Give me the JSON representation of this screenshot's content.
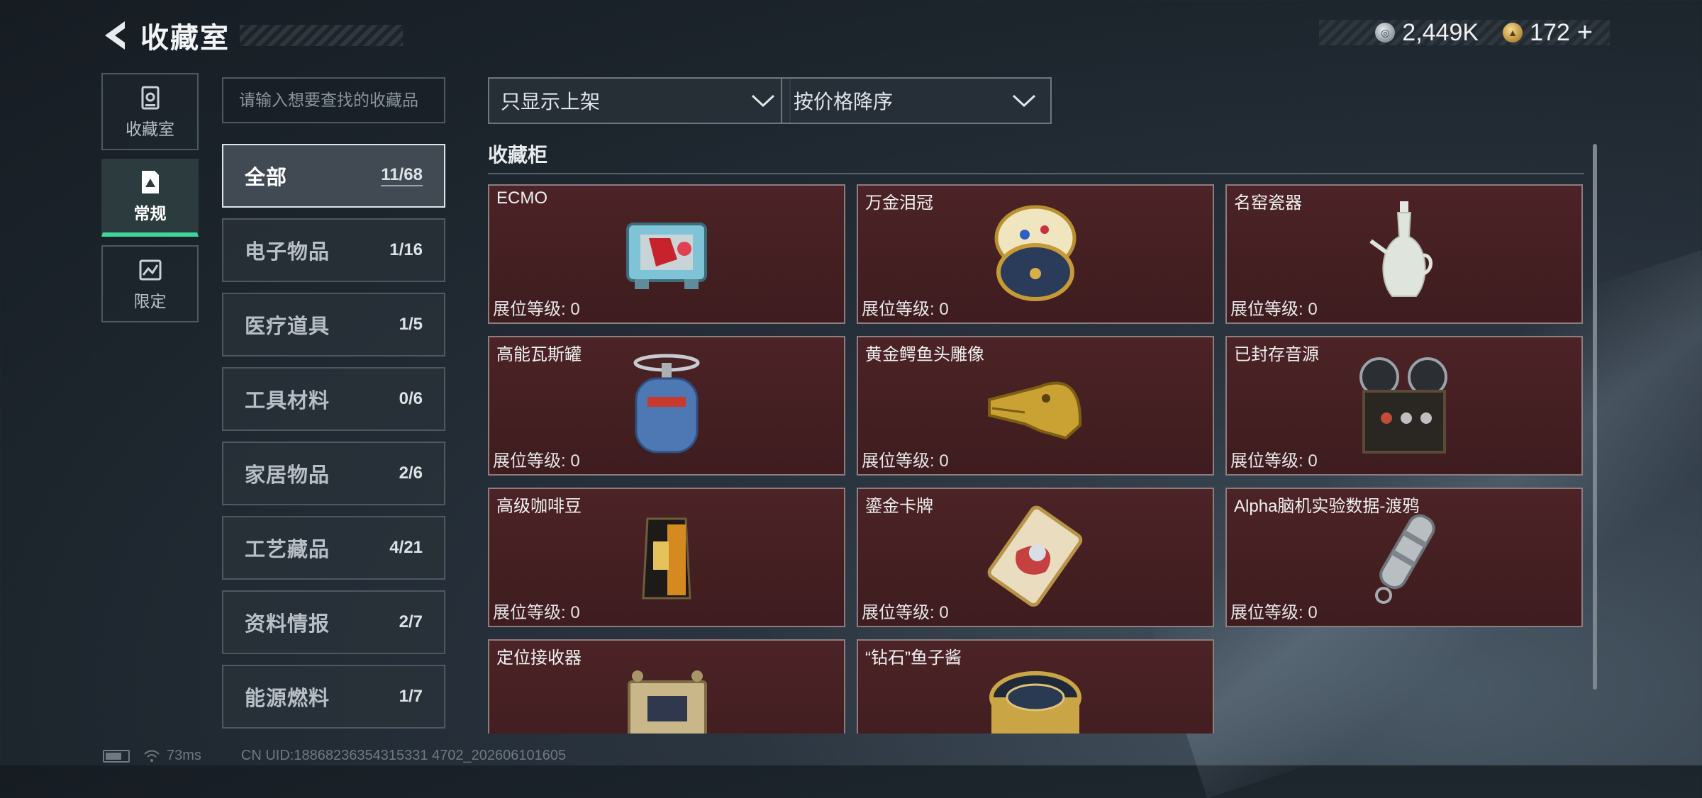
{
  "header": {
    "title": "收藏室",
    "currency_silver": "2,449K",
    "currency_gold": "172",
    "plus": "+"
  },
  "sidetabs": [
    {
      "label": "收藏室",
      "icon": "vault-icon",
      "active": false
    },
    {
      "label": "常规",
      "icon": "document-icon",
      "active": true
    },
    {
      "label": "限定",
      "icon": "limited-icon",
      "active": false
    }
  ],
  "search": {
    "placeholder": "请输入想要查找的收藏品"
  },
  "categories": [
    {
      "name": "全部",
      "count": "11/68",
      "active": true
    },
    {
      "name": "电子物品",
      "count": "1/16"
    },
    {
      "name": "医疗道具",
      "count": "1/5"
    },
    {
      "name": "工具材料",
      "count": "0/6"
    },
    {
      "name": "家居物品",
      "count": "2/6"
    },
    {
      "name": "工艺藏品",
      "count": "4/21"
    },
    {
      "name": "资料情报",
      "count": "2/7"
    },
    {
      "name": "能源燃料",
      "count": "1/7"
    }
  ],
  "filters": {
    "display": "只显示上架",
    "sort": "按价格降序"
  },
  "section": {
    "title": "收藏柜"
  },
  "items": [
    {
      "name": "ECMO",
      "level": "展位等级: 0",
      "art": "ecmo-machine-icon"
    },
    {
      "name": "万金泪冠",
      "level": "展位等级: 0",
      "art": "jeweled-egg-icon"
    },
    {
      "name": "名窑瓷器",
      "level": "展位等级: 0",
      "art": "porcelain-vase-icon"
    },
    {
      "name": "高能瓦斯罐",
      "level": "展位等级: 0",
      "art": "gas-canister-icon"
    },
    {
      "name": "黄金鳄鱼头雕像",
      "level": "展位等级: 0",
      "art": "gold-crocodile-icon"
    },
    {
      "name": "已封存音源",
      "level": "展位等级: 0",
      "art": "tape-recorder-icon"
    },
    {
      "name": "高级咖啡豆",
      "level": "展位等级: 0",
      "art": "coffee-bag-icon"
    },
    {
      "name": "鎏金卡牌",
      "level": "展位等级: 0",
      "art": "gold-card-icon"
    },
    {
      "name": "Alpha脑机实验数据-渡鸦",
      "level": "展位等级: 0",
      "art": "data-capsule-icon"
    },
    {
      "name": "定位接收器",
      "level": "",
      "art": "receiver-icon"
    },
    {
      "name": "“钻石”鱼子酱",
      "level": "",
      "art": "caviar-tin-icon"
    }
  ],
  "status": {
    "ping": "73ms",
    "uid": "CN UID:18868236354315331 4702_202606101605"
  }
}
